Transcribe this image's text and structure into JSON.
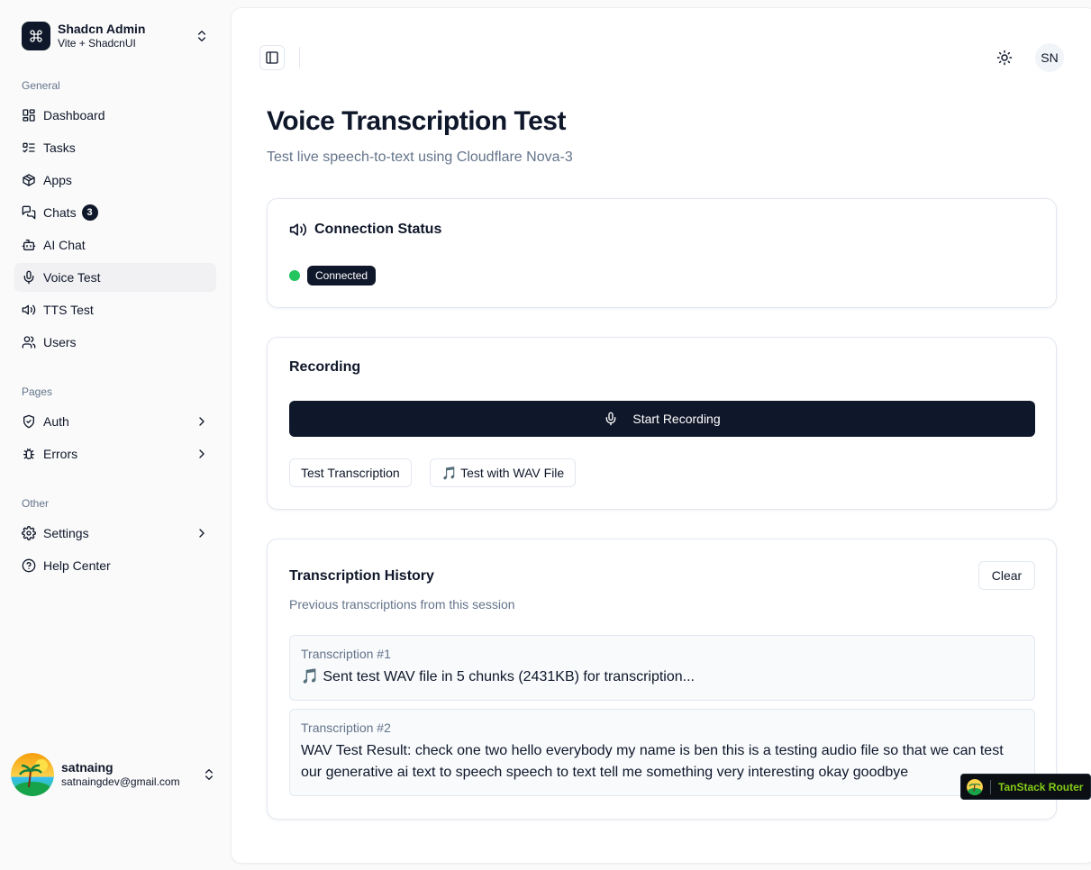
{
  "team": {
    "name": "Shadcn Admin",
    "subtitle": "Vite + ShadcnUI",
    "logo_icon": "command-icon"
  },
  "sidebar": {
    "groups": [
      {
        "label": "General"
      },
      {
        "label": "Pages"
      },
      {
        "label": "Other"
      }
    ],
    "items": [
      {
        "label": "Dashboard",
        "icon": "layout-dashboard-icon"
      },
      {
        "label": "Tasks",
        "icon": "list-todo-icon"
      },
      {
        "label": "Apps",
        "icon": "package-icon"
      },
      {
        "label": "Chats",
        "icon": "messages-icon",
        "badge": "3"
      },
      {
        "label": "AI Chat",
        "icon": "bot-icon"
      },
      {
        "label": "Voice Test",
        "icon": "mic-icon",
        "active": true
      },
      {
        "label": "TTS Test",
        "icon": "volume-icon"
      },
      {
        "label": "Users",
        "icon": "users-icon"
      },
      {
        "label": "Auth",
        "icon": "shield-check-icon"
      },
      {
        "label": "Errors",
        "icon": "bug-icon"
      },
      {
        "label": "Settings",
        "icon": "settings-icon"
      },
      {
        "label": "Help Center",
        "icon": "help-circle-icon"
      }
    ]
  },
  "user": {
    "name": "satnaing",
    "email": "satnaingdev@gmail.com"
  },
  "header": {
    "avatar_initials": "SN"
  },
  "page": {
    "title": "Voice Transcription Test",
    "subtitle": "Test live speech-to-text using Cloudflare Nova-3"
  },
  "connection": {
    "title": "Connection Status",
    "status": "Connected",
    "status_color": "#22c55e"
  },
  "recording": {
    "title": "Recording",
    "start_label": "Start Recording",
    "test_transcription_label": "Test Transcription",
    "test_wav_label": "🎵 Test with WAV File"
  },
  "history": {
    "title": "Transcription History",
    "description": "Previous transcriptions from this session",
    "clear_label": "Clear",
    "items": [
      {
        "label": "Transcription #1",
        "text": "🎵 Sent test WAV file in 5 chunks (2431KB) for transcription..."
      },
      {
        "label": "Transcription #2",
        "text": "WAV Test Result: check one two hello everybody my name is ben this is a testing audio file so that we can test our generative ai text to speech speech to text tell me something very interesting okay goodbye"
      }
    ]
  },
  "devtools": {
    "label": "TanStack Router"
  },
  "colors": {
    "primary": "#0f172a",
    "muted": "#64748b",
    "border": "#e2e8f0",
    "accent_green": "#22c55e"
  }
}
